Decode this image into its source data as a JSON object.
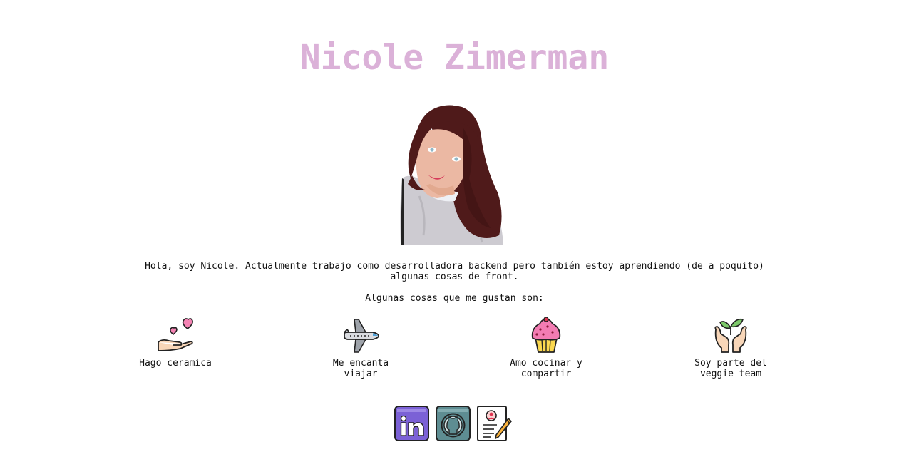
{
  "header": {
    "name": "Nicole Zimerman"
  },
  "intro": {
    "text": "Hola, soy Nicole. Actualmente trabajo como desarrolladora backend pero también estoy aprendiendo (de a poquito) algunas cosas de front."
  },
  "likes": {
    "heading": "Algunas cosas que me gustan son:",
    "items": [
      {
        "label": "Hago ceramica",
        "icon": "hand-hearts-icon"
      },
      {
        "label": "Me encanta viajar",
        "icon": "airplane-icon"
      },
      {
        "label": "Amo cocinar y compartir",
        "icon": "cupcake-icon"
      },
      {
        "label": "Soy parte del veggie team",
        "icon": "hands-plant-icon"
      }
    ]
  },
  "socials": [
    {
      "name": "LinkedIn",
      "icon": "linkedin-icon",
      "color": "#7b61d6"
    },
    {
      "name": "GitHub",
      "icon": "github-icon",
      "color": "#5e8d92"
    },
    {
      "name": "CV",
      "icon": "resume-icon",
      "color": "#ffffff"
    }
  ]
}
